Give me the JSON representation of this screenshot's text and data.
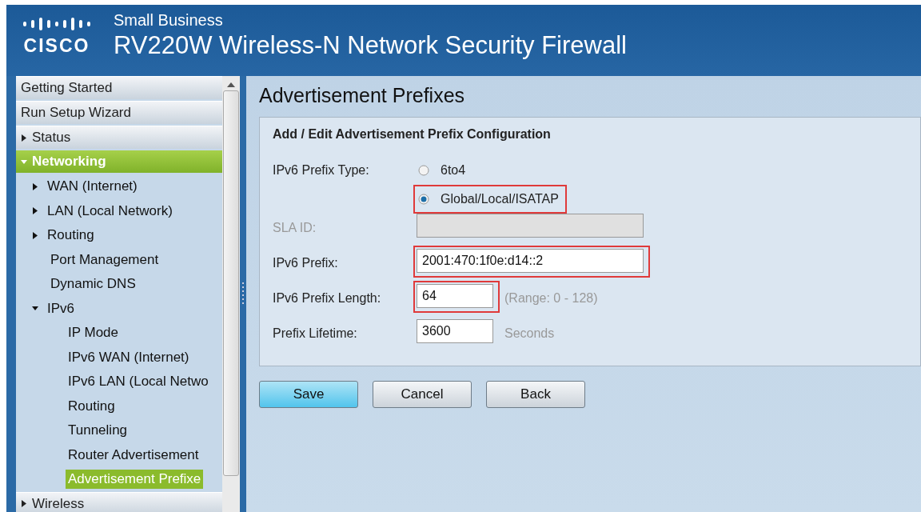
{
  "header": {
    "logo_text": "CISCO",
    "subtitle": "Small Business",
    "title": "RV220W Wireless-N Network Security Firewall"
  },
  "sidebar": {
    "items": [
      {
        "label": "Getting Started",
        "selected": false
      },
      {
        "label": "Run Setup Wizard",
        "selected": false
      },
      {
        "label": "Status",
        "selected": false,
        "expanded": false
      },
      {
        "label": "Networking",
        "selected": true,
        "expanded": true,
        "children": [
          {
            "label": "WAN (Internet)",
            "selected": false,
            "expanded": false
          },
          {
            "label": "LAN (Local Network)",
            "selected": false,
            "expanded": false
          },
          {
            "label": "Routing",
            "selected": false,
            "expanded": false
          },
          {
            "label": "Port Management",
            "selected": false
          },
          {
            "label": "Dynamic DNS",
            "selected": false
          },
          {
            "label": "IPv6",
            "selected": false,
            "expanded": true,
            "children": [
              {
                "label": "IP Mode",
                "selected": false
              },
              {
                "label": "IPv6 WAN (Internet)",
                "selected": false
              },
              {
                "label": "IPv6 LAN (Local Netwo",
                "selected": false
              },
              {
                "label": "Routing",
                "selected": false
              },
              {
                "label": "Tunneling",
                "selected": false
              },
              {
                "label": "Router Advertisement",
                "selected": false
              },
              {
                "label": "Advertisement Prefixe",
                "selected": true
              }
            ]
          }
        ]
      },
      {
        "label": "Wireless",
        "selected": false,
        "expanded": false
      }
    ]
  },
  "page": {
    "title": "Advertisement Prefixes",
    "panel": {
      "heading": "Add / Edit Advertisement Prefix Configuration",
      "fields": [
        {
          "kind": "radio",
          "label": "IPv6 Prefix Type:",
          "options": [
            {
              "label": "6to4",
              "selected": false,
              "highlighted": false
            },
            {
              "label": "Global/Local/ISATAP",
              "selected": true,
              "highlighted": true
            }
          ]
        },
        {
          "kind": "text",
          "label": "SLA ID:",
          "disabled": true,
          "highlighted": false
        },
        {
          "kind": "text",
          "label": "IPv6 Prefix:",
          "value": "2001:470:1f0e:d14::2",
          "disabled": false,
          "highlighted": true
        },
        {
          "kind": "short",
          "label": "IPv6 Prefix Length:",
          "value": "64",
          "hint": "(Range: 0 - 128)",
          "disabled": false,
          "highlighted": true
        },
        {
          "kind": "short",
          "label": "Prefix Lifetime:",
          "value": "3600",
          "hint": "Seconds",
          "disabled": false,
          "highlighted": false
        }
      ]
    },
    "buttons": [
      {
        "label": "Save",
        "primary": true
      },
      {
        "label": "Cancel",
        "primary": false
      },
      {
        "label": "Back",
        "primary": false
      }
    ]
  }
}
